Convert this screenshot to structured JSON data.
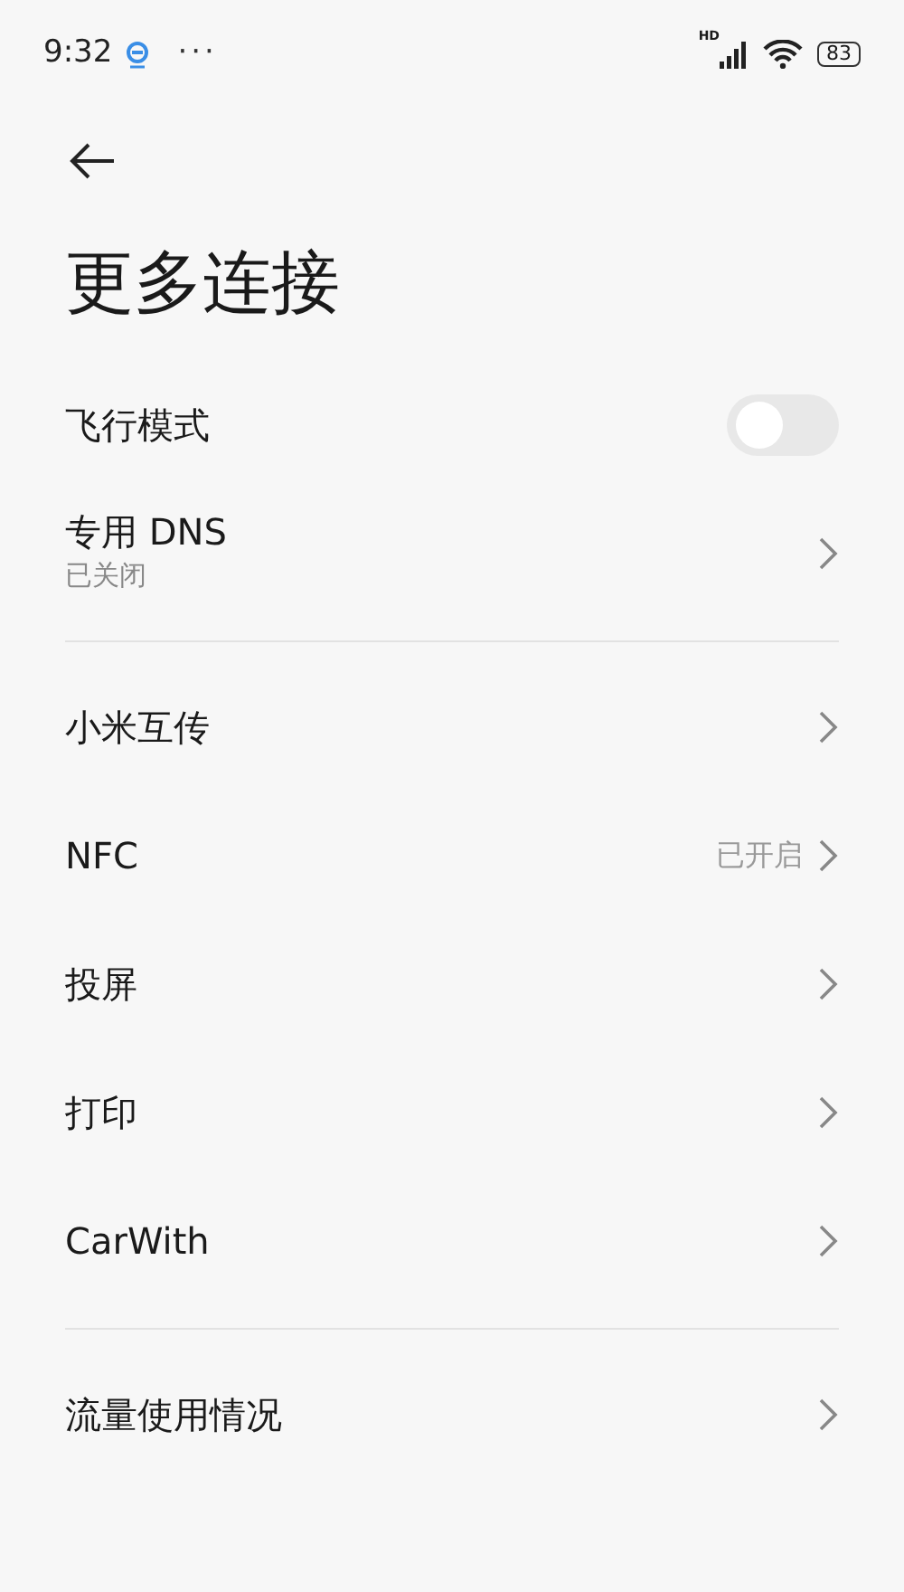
{
  "status_bar": {
    "time": "9:32",
    "more": "···",
    "network_label": "HD",
    "battery": "83"
  },
  "title": "更多连接",
  "sections": [
    {
      "items": [
        {
          "kind": "toggle",
          "title": "飞行模式",
          "on": false
        },
        {
          "kind": "link",
          "title": "专用 DNS",
          "subtitle": "已关闭"
        }
      ]
    },
    {
      "items": [
        {
          "kind": "link",
          "title": "小米互传"
        },
        {
          "kind": "link",
          "title": "NFC",
          "value": "已开启"
        },
        {
          "kind": "link",
          "title": "投屏"
        },
        {
          "kind": "link",
          "title": "打印"
        },
        {
          "kind": "link",
          "title": "CarWith"
        }
      ]
    },
    {
      "items": [
        {
          "kind": "link",
          "title": "流量使用情况"
        }
      ]
    }
  ]
}
